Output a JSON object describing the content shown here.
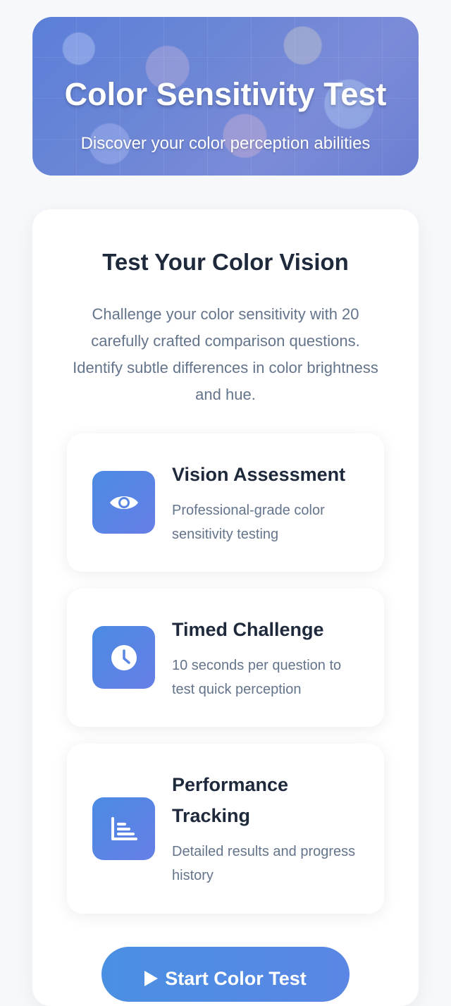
{
  "header": {
    "title": "Color Sensitivity Test",
    "subtitle": "Discover your color perception abilities"
  },
  "intro": {
    "title": "Test Your Color Vision",
    "description": "Challenge your color sensitivity with 20 carefully crafted comparison questions. Identify subtle differences in color brightness and hue."
  },
  "features": [
    {
      "icon": "eye-icon",
      "title": "Vision Assessment",
      "text": "Professional-grade color sensitivity testing"
    },
    {
      "icon": "clock-icon",
      "title": "Timed Challenge",
      "text": "10 seconds per question to test quick perception"
    },
    {
      "icon": "bar-chart-icon",
      "title": "Performance Tracking",
      "text": "Detailed results and progress history"
    }
  ],
  "actions": {
    "start_label": "Start Color Test",
    "start_icon": "play-icon"
  },
  "colors": {
    "accent": "#4a90e2",
    "icon_gradient_start": "#4b8be3",
    "icon_gradient_end": "#667ee6"
  }
}
